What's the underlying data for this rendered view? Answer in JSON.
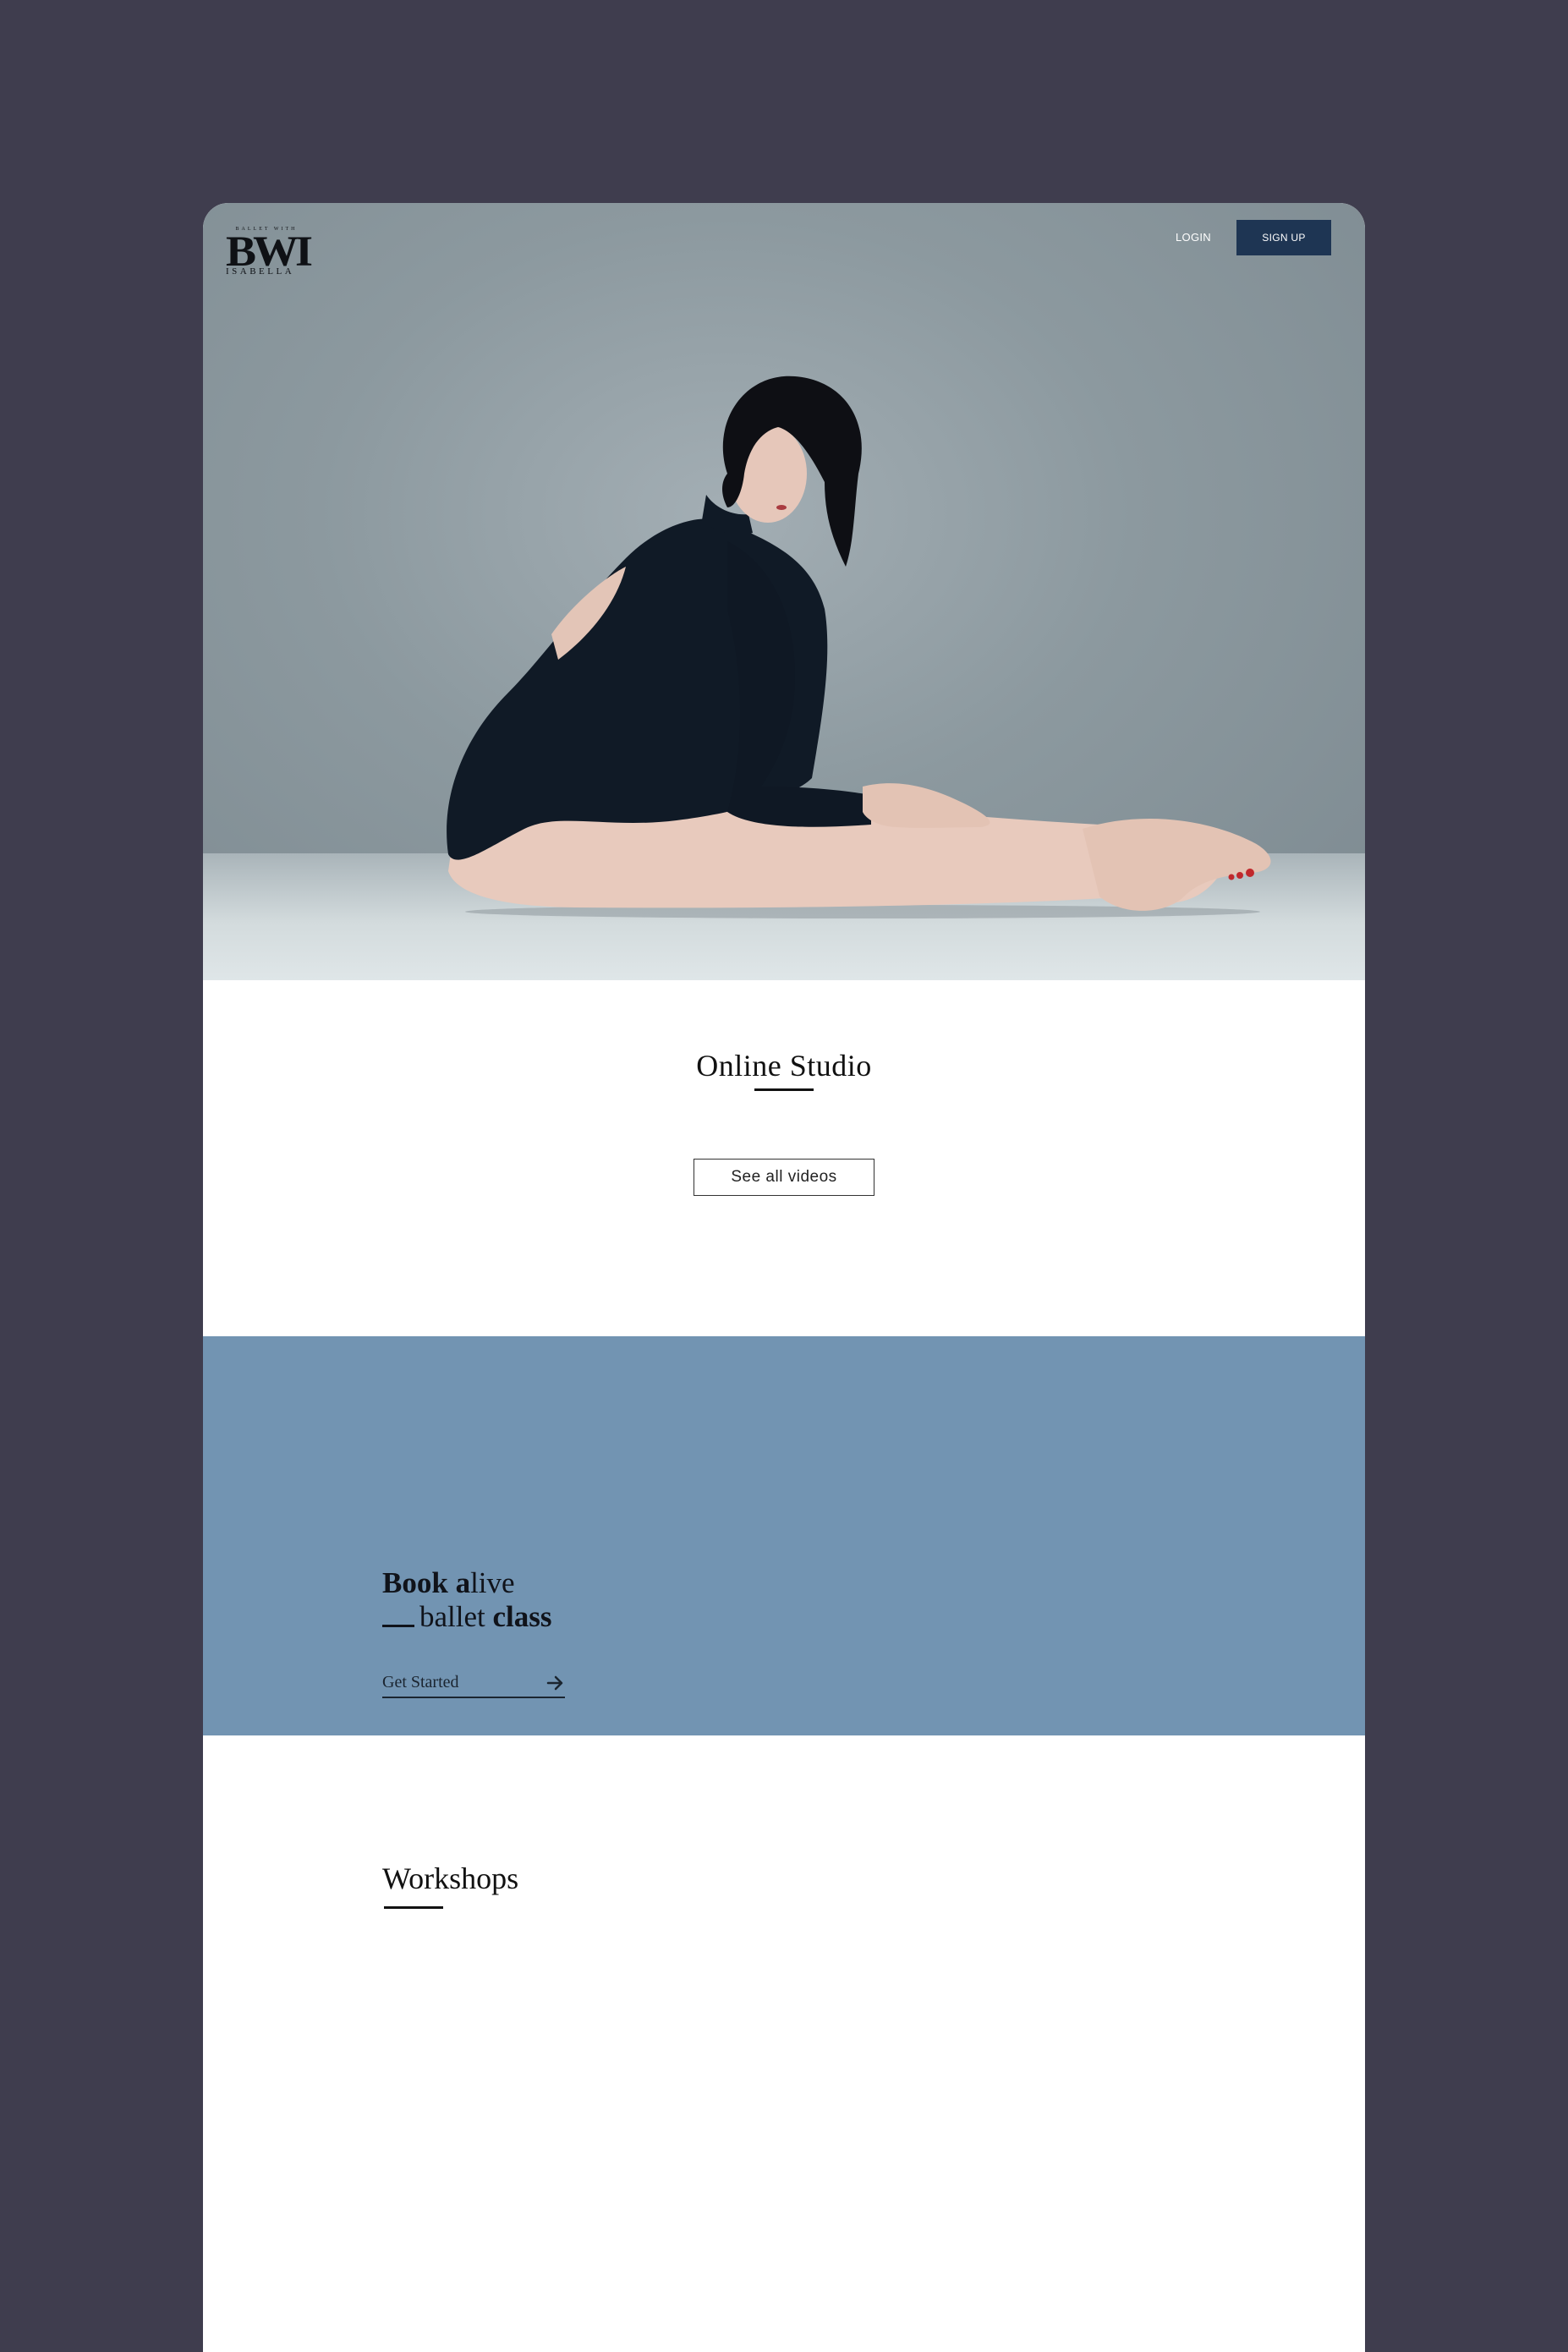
{
  "header": {
    "logo": {
      "top_text": "BALLET WITH",
      "mark": "BWI",
      "bottom_text": "ISABELLA"
    },
    "login_label": "LOGIN",
    "signup_label": "SIGN UP"
  },
  "hero": {
    "image_subject": "dancer seated stretching"
  },
  "studio": {
    "title": "Online Studio",
    "button_label": "See all videos"
  },
  "book": {
    "line1_bold": "Book",
    "line1_a": "a",
    "line1_rest": "live",
    "line2_light": "ballet",
    "line2_bold": "class",
    "cta_label": "Get Started",
    "cta_icon": "arrow-right-icon"
  },
  "workshops": {
    "title": "Workshops"
  },
  "colors": {
    "page_bg": "#3f3d4e",
    "accent_blue": "#7294b2",
    "button_navy": "#1e3553",
    "text_dark": "#111111"
  }
}
